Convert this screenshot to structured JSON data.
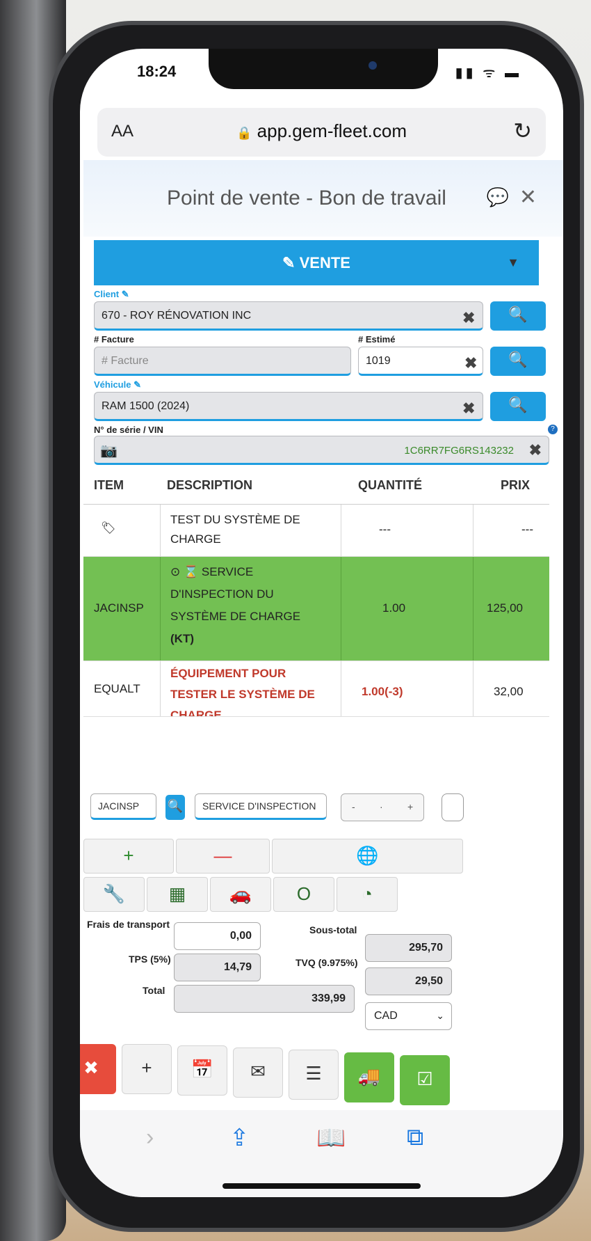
{
  "status": {
    "time": "18:24",
    "icons": "▮▮ ᯤ ▬"
  },
  "browser": {
    "aa": "AA",
    "url": "app.gem-fleet.com",
    "lock": "🔒",
    "reload": "↻"
  },
  "app": {
    "title": "Point de vente - Bon de travail",
    "chat_icon": "💬",
    "close_icon": "✕",
    "mode_label": "✎ VENTE",
    "mode_caret": "▼"
  },
  "form": {
    "client_label": "Client ✎",
    "client_value": "670 - ROY RÉNOVATION INC",
    "facture_label": "# Facture",
    "facture_placeholder": "# Facture",
    "estime_label": "# Estimé",
    "estime_value": "1019",
    "vehicule_label": "Véhicule ✎",
    "vehicule_value": "RAM 1500 (2024)",
    "vin_label": "N° de série / VIN",
    "vin_value": "1C6RR7FG6RS143232",
    "clear": "✖",
    "search": "🔍",
    "help": "?",
    "camera": "📷"
  },
  "table": {
    "headers": {
      "item": "ITEM",
      "description": "DESCRIPTION",
      "quantite": "QUANTITÉ",
      "prix": "PRIX"
    },
    "rows": [
      {
        "item": "🏷",
        "desc": [
          "TEST DU SYSTÈME DE",
          "CHARGE"
        ],
        "qty": "---",
        "price": "---"
      },
      {
        "item": "JACINSP",
        "desc": [
          "⊙ ⌛ SERVICE",
          "D'INSPECTION DU",
          "SYSTÈME DE CHARGE",
          "(KT)"
        ],
        "qty": "1.00",
        "price": "125,00"
      },
      {
        "item": "EQUALT",
        "desc": [
          "ÉQUIPEMENT POUR",
          "TESTER LE SYSTÈME DE",
          "CHARGE"
        ],
        "qty": "1.00(-3)",
        "price": "32,00"
      }
    ]
  },
  "entry": {
    "code": "JACINSP",
    "search": "🔍",
    "desc": "SERVICE D'INSPECTION",
    "minus": "-",
    "dot": "·",
    "plus": "+"
  },
  "toolbar": {
    "add": "+",
    "remove": "—",
    "globe": "🌐",
    "wrench": "🔧",
    "grid": "▦",
    "car": "🚗",
    "circle": "O",
    "gauge": "◔"
  },
  "totals": {
    "transport_label": "Frais de transport",
    "transport_value": "0,00",
    "soustotal_label": "Sous-total",
    "soustotal_value": "295,70",
    "tps_label": "TPS (5%)",
    "tps_value": "14,79",
    "tvq_label": "TVQ (9.975%)",
    "tvq_value": "29,50",
    "total_label": "Total",
    "total_value": "339,99",
    "currency": "CAD",
    "currency_caret": "⌄"
  },
  "actions": {
    "cancel": "✖",
    "new": "+",
    "calendar": "📅",
    "mail": "✉",
    "list": "☰",
    "truck": "🚚",
    "confirm": "☑"
  },
  "safari": {
    "back": "‹",
    "forward": "›",
    "share": "⇪",
    "bookmarks": "📖",
    "tabs": "⧉"
  }
}
